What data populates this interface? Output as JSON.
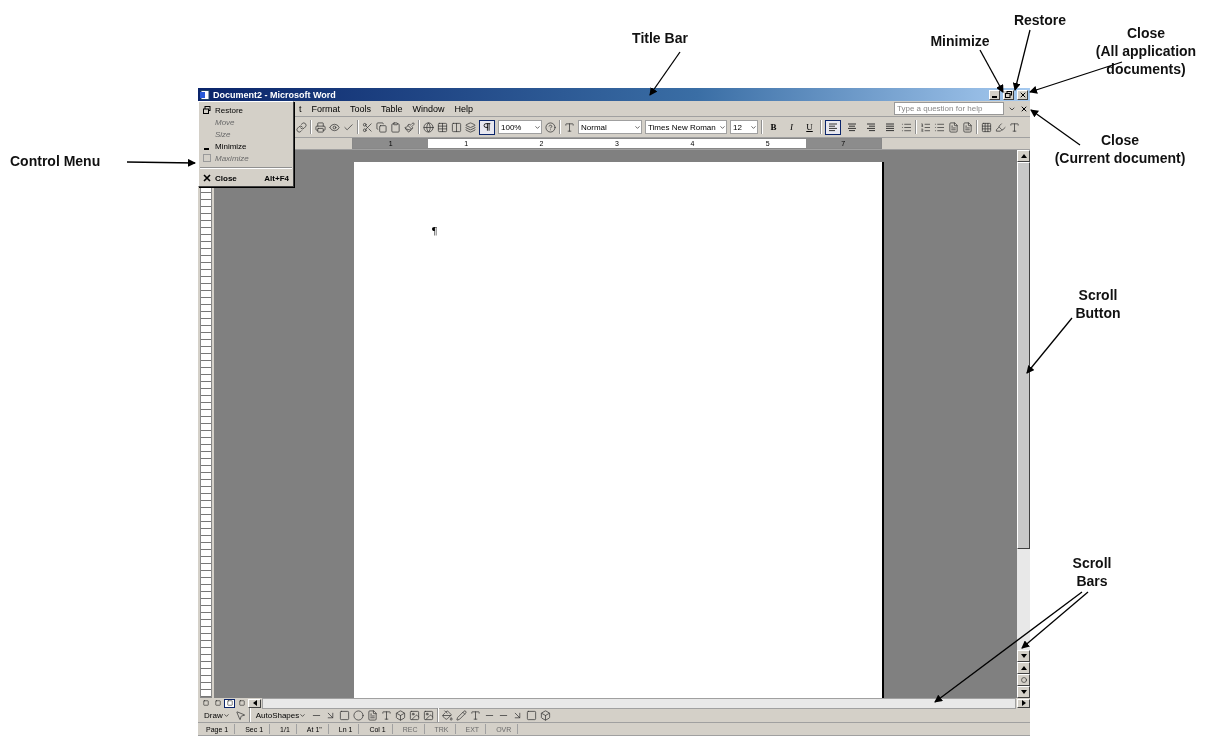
{
  "annotations": [
    {
      "lines": [
        "Restore"
      ]
    },
    {
      "lines": [
        "Title Bar"
      ]
    },
    {
      "lines": [
        "Minimize"
      ]
    },
    {
      "lines": [
        "Close",
        "(All application",
        "documents)"
      ]
    },
    {
      "lines": [
        "Control Menu"
      ]
    },
    {
      "lines": [
        "Close",
        "(Current document)"
      ]
    },
    {
      "lines": [
        "Scroll",
        "Button"
      ]
    },
    {
      "lines": [
        "Scroll",
        "Bars"
      ]
    }
  ],
  "window": {
    "title": "Document2 - Microsoft Word"
  },
  "control_menu": [
    {
      "kind": "restore",
      "label": "Restore",
      "disabled": false
    },
    {
      "kind": "move",
      "label": "Move",
      "disabled": true
    },
    {
      "kind": "size",
      "label": "Size",
      "disabled": true
    },
    {
      "kind": "minimize",
      "label": "Minimize",
      "disabled": false
    },
    {
      "kind": "maximize",
      "label": "Maximize",
      "disabled": true
    },
    {
      "kind": "close",
      "label": "Close",
      "shortcut": "Alt+F4",
      "disabled": false
    }
  ],
  "menu_bar": {
    "items": [
      "t",
      "Format",
      "Tools",
      "Table",
      "Window",
      "Help"
    ],
    "help_box": {
      "placeholder": "Type a question for help"
    }
  },
  "toolbar": {
    "zoom": "100%",
    "show_marks": true,
    "style": "Normal",
    "font": "Times New Roman",
    "size": "12",
    "bold": "B",
    "italic": "I",
    "underline": "U",
    "align_buttons": [
      {
        "selected": true
      },
      {
        "selected": false
      },
      {
        "selected": false
      },
      {
        "selected": false
      }
    ]
  },
  "ruler": {
    "labels": [
      {
        "text": "1",
        "margin": true
      },
      {
        "text": "1",
        "margin": false
      },
      {
        "text": "2",
        "margin": false
      },
      {
        "text": "3",
        "margin": false
      },
      {
        "text": "4",
        "margin": false
      },
      {
        "text": "5",
        "margin": false
      },
      {
        "text": "7",
        "margin": true
      }
    ]
  },
  "document": {
    "mark": "¶"
  },
  "view_buttons": [
    {
      "selected": false
    },
    {
      "selected": false
    },
    {
      "selected": true
    },
    {
      "selected": false
    }
  ],
  "drawing_toolbar": {
    "draw": "Draw",
    "autoshapes": "AutoShapes"
  },
  "status_bar": [
    {
      "text": "Page 1",
      "disabled": false
    },
    {
      "text": "Sec 1",
      "disabled": false
    },
    {
      "text": "1/1",
      "disabled": false
    },
    {
      "text": "At 1\"",
      "disabled": false
    },
    {
      "text": "Ln 1",
      "disabled": false
    },
    {
      "text": "Col 1",
      "disabled": false
    },
    {
      "text": "REC",
      "disabled": true
    },
    {
      "text": "TRK",
      "disabled": true
    },
    {
      "text": "EXT",
      "disabled": true
    },
    {
      "text": "OVR",
      "disabled": true
    }
  ]
}
